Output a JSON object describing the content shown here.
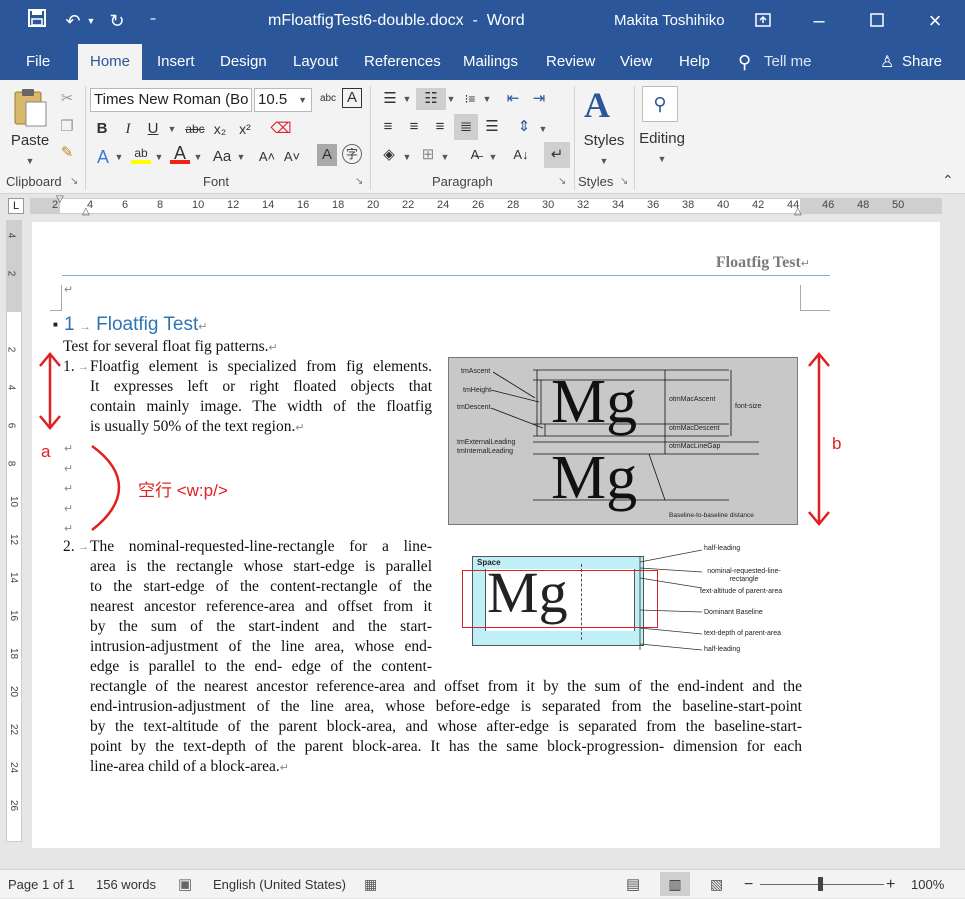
{
  "titlebar": {
    "filename": "mFloatfigTest6-double.docx",
    "app": "Word",
    "user": "Makita Toshihiko"
  },
  "tabs": [
    "File",
    "Home",
    "Insert",
    "Design",
    "Layout",
    "References",
    "Mailings",
    "Review",
    "View",
    "Help"
  ],
  "tell_me": "Tell me",
  "share": "Share",
  "ribbon": {
    "paste": "Paste",
    "clipboard": "Clipboard",
    "font_name": "Times New Roman (Bo",
    "font_size": "10.5",
    "font": "Font",
    "paragraph": "Paragraph",
    "styles": "Styles",
    "editing": "Editing",
    "bold": "B",
    "italic": "I",
    "underline": "U",
    "strike": "abc",
    "sub": "x₂",
    "sup": "x²",
    "font_color": "A",
    "change_case": "Aa",
    "grow": "A˄",
    "shrink": "A˅"
  },
  "ruler": {
    "h_marks": [
      "2",
      "4",
      "6",
      "8",
      "10",
      "12",
      "14",
      "16",
      "18",
      "20",
      "22",
      "24",
      "26",
      "28",
      "30",
      "32",
      "34",
      "36",
      "38",
      "40",
      "42",
      "44",
      "46",
      "48",
      "50"
    ],
    "v_marks": [
      "4",
      "2",
      "",
      "2",
      "4",
      "6",
      "8",
      "10",
      "12",
      "14",
      "16",
      "18",
      "20",
      "22",
      "24",
      "26"
    ]
  },
  "doc": {
    "header": "Floatfig Test",
    "heading_num": "1",
    "heading": "Floatfig Test",
    "intro": "Test for several float fig patterns.",
    "item1_num": "1.",
    "item1_lines": [
      "Floatfig element is specialized from fig elements.",
      "It expresses left or right floated objects that",
      "contain mainly image. The width of the floatfig",
      "is usually 50% of the text region."
    ],
    "item2_num": "2.",
    "item2_lines": [
      "The nominal-requested-line-rectangle for a line-",
      "area is the rectangle whose start-edge is parallel",
      "to the start-edge of the content-rectangle of the",
      "nearest ancestor reference-area and offset from it",
      "by the sum of the start-indent and the start-",
      "intrusion-adjustment of the line area, whose end-",
      "edge is parallel to the end- edge of the content-",
      "rectangle of the nearest ancestor reference-area and offset from it by the sum of the end-indent and the",
      "end-intrusion-adjustment of the line area, whose before-edge is separated from the baseline-start-point",
      "by the text-altitude of the parent block-area, and whose after-edge is separated from the baseline-start-",
      "point by the text-depth of the parent block-area. It has the same block-progression- dimension for each",
      "line-area child of a block-area."
    ],
    "annot_a": "a",
    "annot_b": "b",
    "annot_empty": "空行 <w:p/>",
    "fig1": {
      "glyph": "Mg",
      "labels": [
        "tmAscent",
        "tmHeight",
        "tmDescent",
        "tmExternalLeading",
        "tmInternalLeading",
        "otmMacAscent",
        "otmMacDescent",
        "otmMacLineGap",
        "font-size",
        "Baseline-to-baseline distance"
      ]
    },
    "fig2": {
      "glyph": "Mg",
      "space": "Space",
      "labels": [
        "half-leading",
        "nominal-requested-line-rectangle",
        "text-altitude of parent-area",
        "Dominant Baseline",
        "text-depth of parent-area",
        "half-leading"
      ]
    }
  },
  "status": {
    "page": "Page 1 of 1",
    "words": "156 words",
    "lang": "English (United States)",
    "zoom": "100%"
  }
}
